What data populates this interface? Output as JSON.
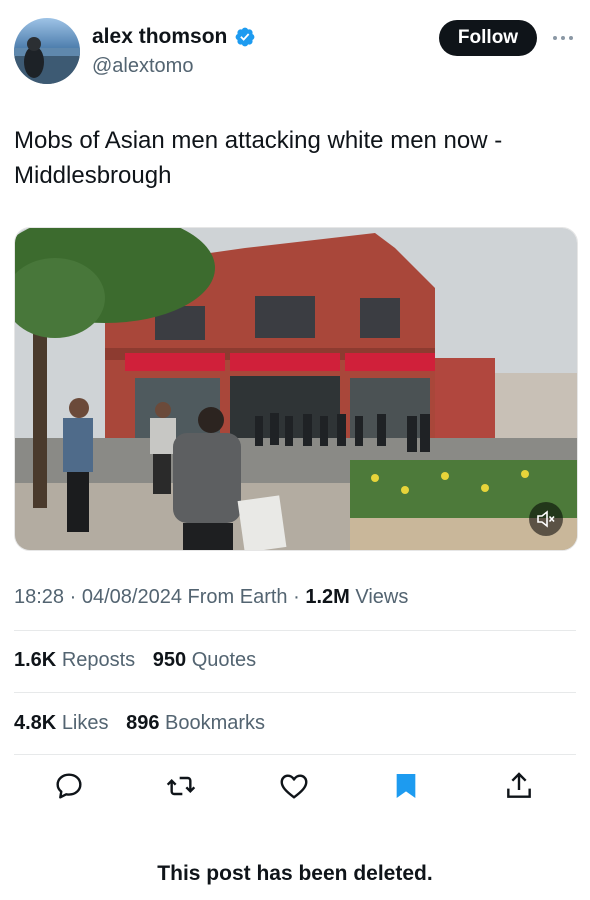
{
  "author": {
    "name": "alex thomson",
    "handle": "@alextomo",
    "verified": true
  },
  "header": {
    "follow_label": "Follow",
    "more_icon": "more-icon"
  },
  "tweet": {
    "text": "Mobs of Asian men attacking white men now - Middlesbrough"
  },
  "meta": {
    "time": "18:28",
    "date": "04/08/2024",
    "source": "From Earth",
    "views_count": "1.2M",
    "views_label": "Views"
  },
  "stats": {
    "reposts_count": "1.6K",
    "reposts_label": "Reposts",
    "quotes_count": "950",
    "quotes_label": "Quotes",
    "likes_count": "4.8K",
    "likes_label": "Likes",
    "bookmarks_count": "896",
    "bookmarks_label": "Bookmarks"
  },
  "actions": [
    "reply-icon",
    "repost-icon",
    "like-icon",
    "bookmark-icon",
    "share-icon"
  ],
  "footer": {
    "deleted_notice": "This post has been deleted."
  },
  "colors": {
    "text": "#0f1419",
    "secondary": "#536471",
    "accent": "#1d9bf0",
    "divider": "#e7e9ea"
  }
}
